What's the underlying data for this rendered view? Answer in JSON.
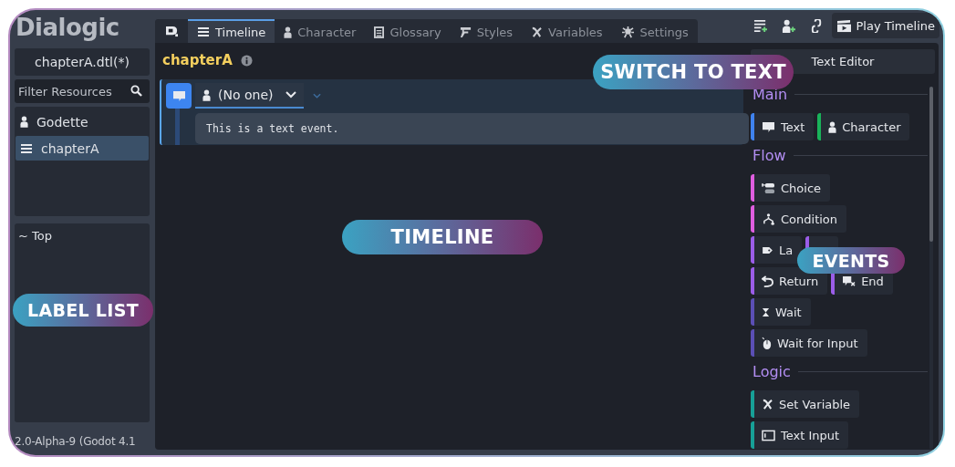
{
  "logo": "Dialogic",
  "file_button": "chapterA.dtl(*)",
  "filter": {
    "placeholder": "Filter Resources"
  },
  "resources": [
    {
      "label": "Godette",
      "kind": "character",
      "selected": false
    },
    {
      "label": "chapterA",
      "kind": "timeline",
      "selected": true
    }
  ],
  "label_list": [
    "~ Top"
  ],
  "version": "2.0-Alpha-9 (Godot 4.1",
  "tabs": [
    {
      "label": "Timeline",
      "selected": true
    },
    {
      "label": "Character",
      "selected": false
    },
    {
      "label": "Glossary",
      "selected": false
    },
    {
      "label": "Styles",
      "selected": false
    },
    {
      "label": "Variables",
      "selected": false
    },
    {
      "label": "Settings",
      "selected": false
    }
  ],
  "play_button": "Play Timeline",
  "timeline_name": "chapterA",
  "event": {
    "character": "(No one)",
    "text": "This is a text event."
  },
  "text_editor_button": "Text Editor",
  "event_sections": [
    {
      "title": "Main",
      "rows": [
        [
          {
            "label": "Text",
            "color": "#3f82ee"
          },
          {
            "label": "Character",
            "color": "#19b35a"
          }
        ]
      ]
    },
    {
      "title": "Flow",
      "rows": [
        [
          {
            "label": "Choice",
            "color": "#e05ee0"
          }
        ],
        [
          {
            "label": "Condition",
            "color": "#e05ee0"
          }
        ],
        [
          {
            "label": "La",
            "color": "#9b5de8"
          },
          {
            "color": "#9b5de8"
          }
        ],
        [
          {
            "label": "Return",
            "color": "#9b5de8"
          },
          {
            "label": "End",
            "color": "#9b5de8"
          }
        ],
        [
          {
            "label": "Wait",
            "color": "#5b4fb5"
          }
        ],
        [
          {
            "label": "Wait for Input",
            "color": "#5b4fb5"
          }
        ]
      ]
    },
    {
      "title": "Logic",
      "rows": [
        [
          {
            "label": "Set Variable",
            "color": "#17a097"
          }
        ],
        [
          {
            "label": "Text Input",
            "color": "#17a097"
          }
        ]
      ]
    }
  ],
  "callouts": [
    "SWITCH TO TEXT",
    "TIMELINE",
    "LABEL LIST",
    "EVENTS"
  ]
}
